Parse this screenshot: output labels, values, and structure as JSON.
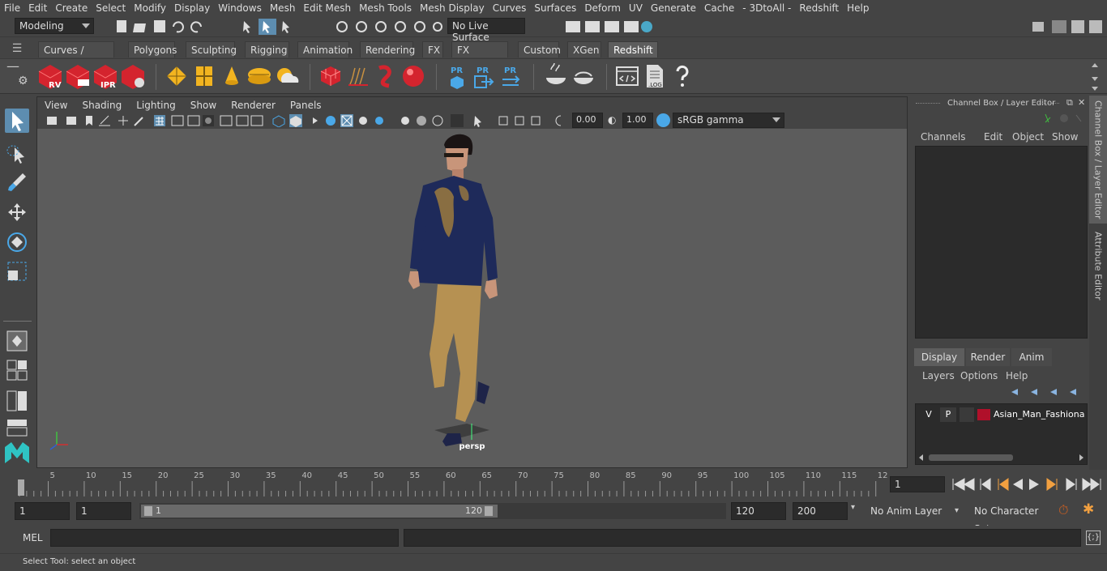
{
  "menubar": [
    "File",
    "Edit",
    "Create",
    "Select",
    "Modify",
    "Display",
    "Windows",
    "Mesh",
    "Edit Mesh",
    "Mesh Tools",
    "Mesh Display",
    "Curves",
    "Surfaces",
    "Deform",
    "UV",
    "Generate",
    "Cache",
    "- 3DtoAll -",
    "Redshift",
    "Help"
  ],
  "status": {
    "workspace": "Modeling",
    "live_surface": "No Live Surface"
  },
  "shelf_tabs": [
    "Curves / Surfaces",
    "Polygons",
    "Sculpting",
    "Rigging",
    "Animation",
    "Rendering",
    "FX",
    "FX Caching",
    "Custom",
    "XGen",
    "Redshift"
  ],
  "shelf_active": "Redshift",
  "shelf_labels": {
    "rv": "RV",
    "ipr": "IPR",
    "pr": "PR",
    "log": ".LOG"
  },
  "panel_menu": [
    "View",
    "Shading",
    "Lighting",
    "Show",
    "Renderer",
    "Panels"
  ],
  "viewport": {
    "exposure": "0.00",
    "gamma": "1.00",
    "colorspace": "sRGB gamma",
    "camera_label": "persp"
  },
  "channel_box": {
    "title": "Channel Box / Layer Editor",
    "menu": [
      "Channels",
      "Edit",
      "Object",
      "Show"
    ]
  },
  "layer_editor": {
    "tabs": [
      "Display",
      "Render",
      "Anim"
    ],
    "active_tab": "Display",
    "menu": [
      "Layers",
      "Options",
      "Help"
    ],
    "layer": {
      "v": "V",
      "p": "P",
      "name": "Asian_Man_Fashionab",
      "color": "#b0102a"
    }
  },
  "side_tabs": [
    "Channel Box / Layer Editor",
    "Attribute Editor"
  ],
  "timeline": {
    "ticks": [
      "5",
      "10",
      "15",
      "20",
      "25",
      "30",
      "35",
      "40",
      "45",
      "50",
      "55",
      "60",
      "65",
      "70",
      "75",
      "80",
      "85",
      "90",
      "95",
      "100",
      "105",
      "110",
      "115",
      "12"
    ],
    "start_label": "1",
    "current_frame": "1"
  },
  "range": {
    "start": "1",
    "start2": "1",
    "range_start": "1",
    "range_end": "120",
    "end": "120",
    "end2": "200",
    "anim_layer": "No Anim Layer",
    "char_set": "No Character Set"
  },
  "cmd": {
    "lang": "MEL"
  },
  "help_text": "Select Tool: select an object"
}
